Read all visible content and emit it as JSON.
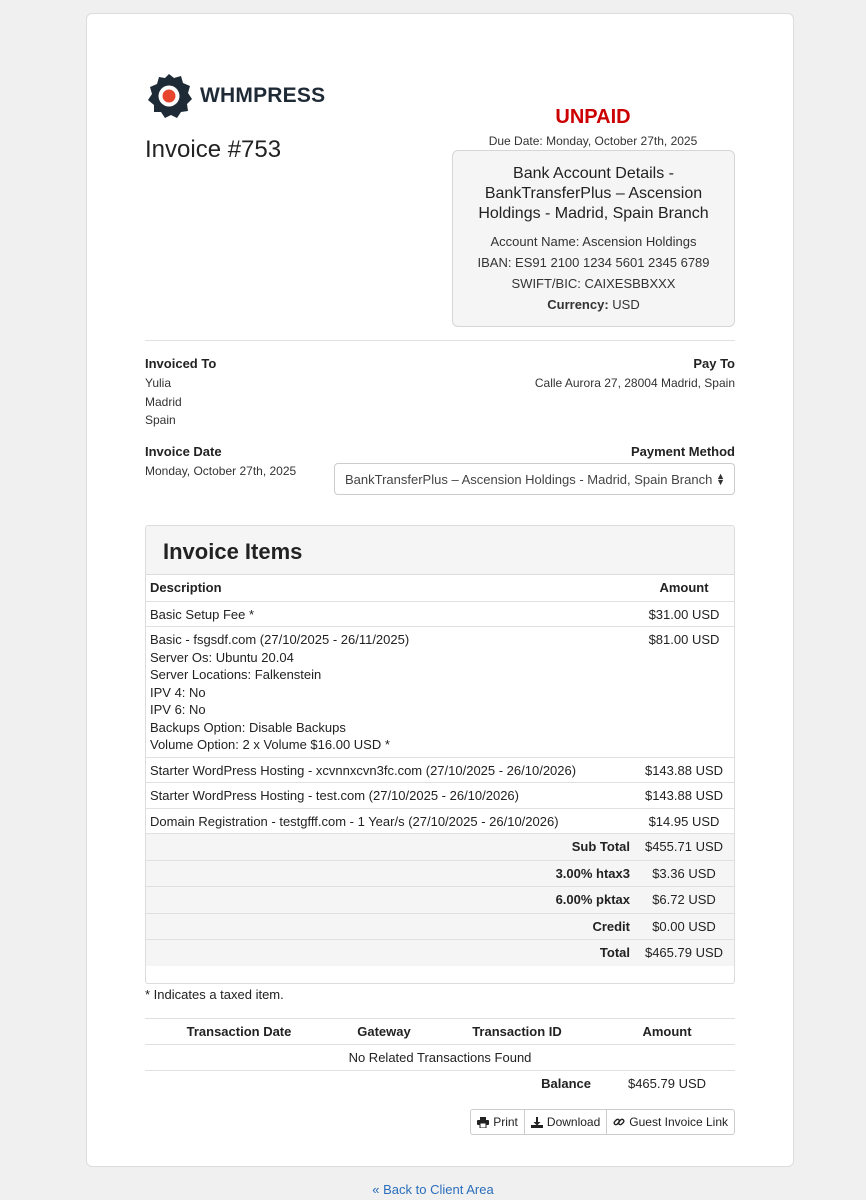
{
  "brand": {
    "name": "WHMPRESS",
    "accent": "#e8452e",
    "dark": "#1e2a36"
  },
  "invoice": {
    "title": "Invoice #753",
    "status": "UNPAID",
    "status_color": "#cc0000",
    "due_date": "Due Date: Monday, October 27th, 2025"
  },
  "bank": {
    "title": "Bank Account Details - BankTransferPlus – Ascension Holdings - Madrid, Spain Branch",
    "account_name": "Account Name: Ascension Holdings",
    "iban": "IBAN: ES91 2100 1234 5601 2345 6789",
    "swift": "SWIFT/BIC: CAIXESBBXXX",
    "currency_label": "Currency:",
    "currency_value": "USD"
  },
  "invoiced_to": {
    "label": "Invoiced To",
    "lines": [
      "Yulia",
      "Madrid",
      "Spain"
    ]
  },
  "pay_to": {
    "label": "Pay To",
    "address": "Calle Aurora 27, 28004 Madrid, Spain"
  },
  "invoice_date": {
    "label": "Invoice Date",
    "value": "Monday, October 27th, 2025"
  },
  "payment_method": {
    "label": "Payment Method",
    "selected": "BankTransferPlus – Ascension Holdings - Madrid, Spain Branch"
  },
  "items_panel": {
    "title": "Invoice Items",
    "col_description": "Description",
    "col_amount": "Amount",
    "rows": [
      {
        "lines": [
          "Basic Setup Fee *"
        ],
        "amount": "$31.00 USD"
      },
      {
        "lines": [
          "Basic - fsgsdf.com (27/10/2025 - 26/11/2025)",
          "Server Os: Ubuntu 20.04",
          "Server Locations: Falkenstein",
          "IPV 4: No",
          "IPV 6: No",
          "Backups Option: Disable Backups",
          "Volume Option: 2 x Volume $16.00 USD *"
        ],
        "amount": "$81.00 USD"
      },
      {
        "lines": [
          "Starter WordPress Hosting - xcvnnxcvn3fc.com (27/10/2025 - 26/10/2026)"
        ],
        "amount": "$143.88 USD"
      },
      {
        "lines": [
          "Starter WordPress Hosting - test.com (27/10/2025 - 26/10/2026)"
        ],
        "amount": "$143.88 USD"
      },
      {
        "lines": [
          "Domain Registration - testgfff.com - 1 Year/s (27/10/2025 - 26/10/2026)"
        ],
        "amount": "$14.95 USD"
      }
    ],
    "summary": [
      {
        "label": "Sub Total",
        "amount": "$455.71 USD"
      },
      {
        "label": "3.00% htax3",
        "amount": "$3.36 USD"
      },
      {
        "label": "6.00% pktax",
        "amount": "$6.72 USD"
      },
      {
        "label": "Credit",
        "amount": "$0.00 USD"
      },
      {
        "label": "Total",
        "amount": "$465.79 USD"
      }
    ]
  },
  "taxed_note": "* Indicates a taxed item.",
  "transactions": {
    "col_date": "Transaction Date",
    "col_gateway": "Gateway",
    "col_id": "Transaction ID",
    "col_amount": "Amount",
    "empty": "No Related Transactions Found",
    "balance_label": "Balance",
    "balance_value": "$465.79 USD"
  },
  "actions": {
    "print": "Print",
    "download": "Download",
    "guest_link": "Guest Invoice Link"
  },
  "back_link": "« Back to Client Area"
}
